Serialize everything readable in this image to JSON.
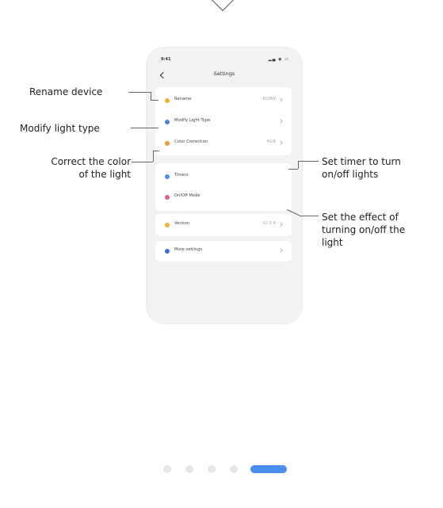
{
  "phone": {
    "status_time": "9:41",
    "status_icons": "▂▄ ◉ ▭",
    "nav_title": "Settings"
  },
  "settings_items": [
    {
      "label": "Rename",
      "value": "RGBW",
      "icon_color": "#f0b22a",
      "icon": "pencil-icon"
    },
    {
      "label": "Modify Light Type",
      "value": "",
      "icon_color": "#4a7fe0",
      "icon": "bulb-icon"
    },
    {
      "label": "Color Correction",
      "value": "RGB",
      "icon_color": "#f09a38",
      "icon": "palette-icon"
    },
    {
      "label": "Timers",
      "value": "",
      "icon_color": "#4a8ef0",
      "icon": "clock-icon"
    },
    {
      "label": "On/Off Mode",
      "value": "",
      "icon_color": "#e0608a",
      "icon": "power-icon"
    },
    {
      "label": "Version",
      "value": "V2.0.8",
      "icon_color": "#f0b22a",
      "icon": "info-icon"
    },
    {
      "label": "More settings",
      "value": "",
      "icon_color": "#3a70d8",
      "icon": "more-icon"
    }
  ],
  "annotations": {
    "rename": "Rename device",
    "modify": "Modify light type",
    "correct_line1": "Correct the color",
    "correct_line2": "of the light",
    "timer_line1": "Set timer to turn",
    "timer_line2": "on/off lights",
    "effect_line1": "Set the effect of",
    "effect_line2": "turning on/off the",
    "effect_line3": "light"
  },
  "pagination": {
    "total": 5,
    "active_index": 4
  }
}
